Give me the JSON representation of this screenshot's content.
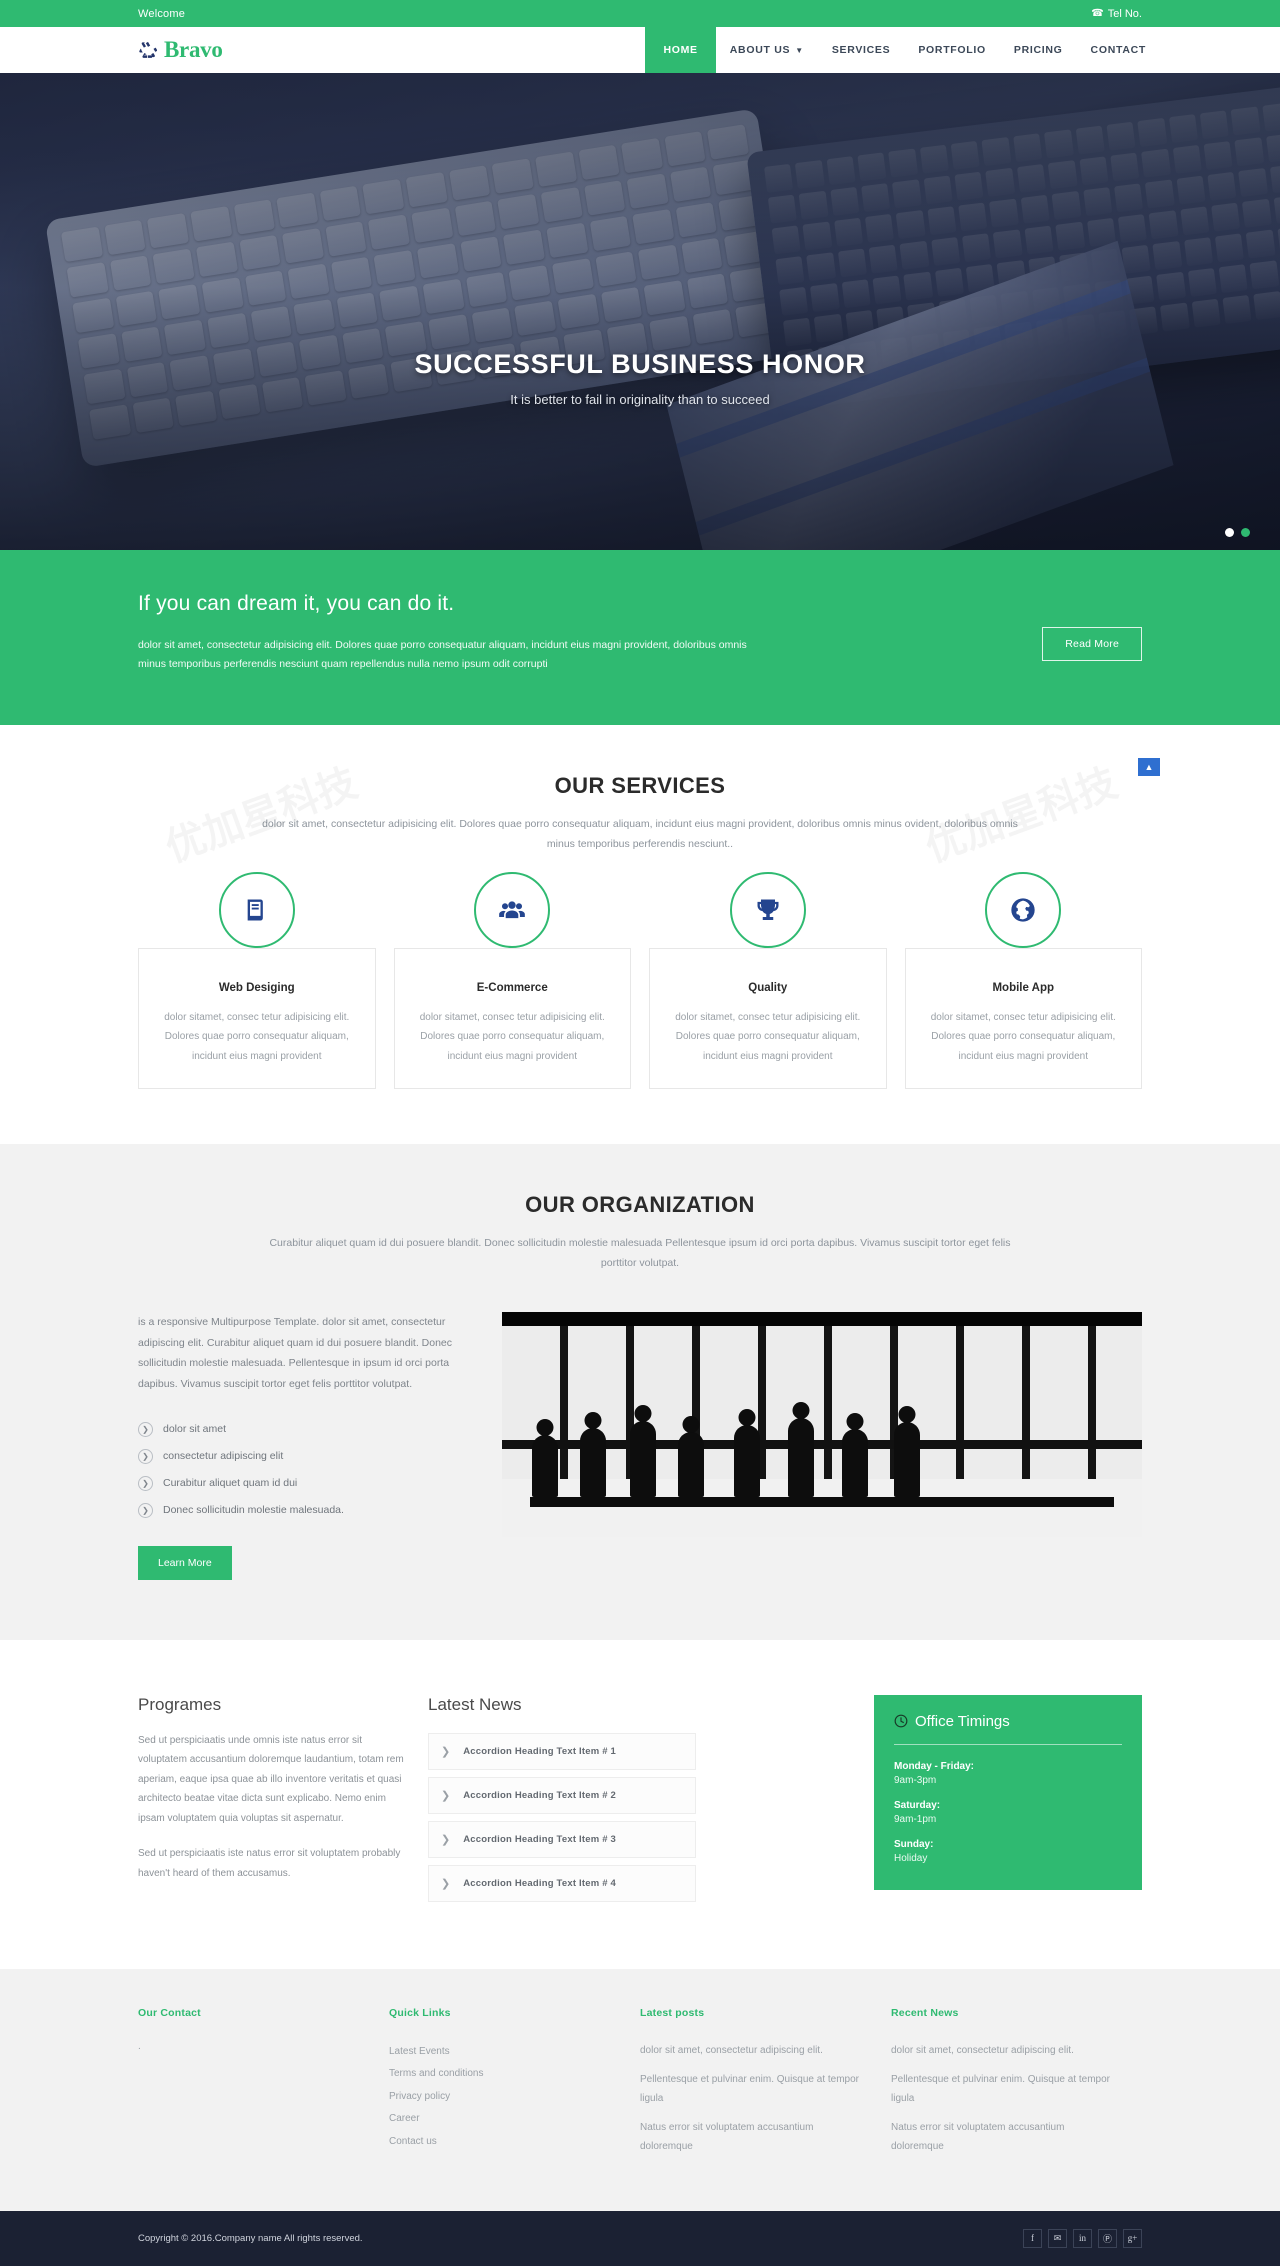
{
  "topbar": {
    "welcome": "Welcome",
    "tel": "Tel No.",
    "phone_icon": "phone-icon"
  },
  "brand": {
    "name": "Bravo",
    "icon": "recycle-icon"
  },
  "nav": {
    "items": [
      {
        "label": "HOME",
        "active": true,
        "caret": false
      },
      {
        "label": "ABOUT US",
        "active": false,
        "caret": true
      },
      {
        "label": "SERVICES",
        "active": false,
        "caret": false
      },
      {
        "label": "PORTFOLIO",
        "active": false,
        "caret": false
      },
      {
        "label": "PRICING",
        "active": false,
        "caret": false
      },
      {
        "label": "CONTACT",
        "active": false,
        "caret": false
      }
    ]
  },
  "hero": {
    "title": "SUCCESSFUL BUSINESS HONOR",
    "subtitle": "It is better to fail in originality than to succeed",
    "dots": [
      {
        "active": false
      },
      {
        "active": true
      }
    ]
  },
  "cta": {
    "title": "If you can dream it, you can do it.",
    "text": "dolor sit amet, consectetur adipisicing elit. Dolores quae porro consequatur aliquam, incidunt eius magni provident, doloribus omnis minus temporibus perferendis nesciunt quam repellendus nulla nemo ipsum odit corrupti",
    "button": "Read More"
  },
  "scrolltop": {
    "icon": "chevron-up-icon"
  },
  "services": {
    "title": "OUR SERVICES",
    "desc": "dolor sit amet, consectetur adipisicing elit. Dolores quae porro consequatur aliquam, incidunt eius magni provident, doloribus omnis minus ovident, doloribus omnis minus temporibus perferendis nesciunt..",
    "cards": [
      {
        "icon": "book-icon",
        "title": "Web Desiging",
        "text": "dolor sitamet, consec tetur adipisicing elit. Dolores quae porro consequatur aliquam, incidunt eius magni provident"
      },
      {
        "icon": "users-icon",
        "title": "E-Commerce",
        "text": "dolor sitamet, consec tetur adipisicing elit. Dolores quae porro consequatur aliquam, incidunt eius magni provident"
      },
      {
        "icon": "trophy-icon",
        "title": "Quality",
        "text": "dolor sitamet, consec tetur adipisicing elit. Dolores quae porro consequatur aliquam, incidunt eius magni provident"
      },
      {
        "icon": "globe-icon",
        "title": "Mobile App",
        "text": "dolor sitamet, consec tetur adipisicing elit. Dolores quae porro consequatur aliquam, incidunt eius magni provident"
      }
    ]
  },
  "organization": {
    "title": "OUR ORGANIZATION",
    "desc": "Curabitur aliquet quam id dui posuere blandit. Donec sollicitudin molestie malesuada Pellentesque ipsum id orci porta dapibus. Vivamus suscipit tortor eget felis porttitor volutpat.",
    "paragraph": "is a responsive Multipurpose Template. dolor sit amet, consectetur adipiscing elit. Curabitur aliquet quam id dui posuere blandit. Donec sollicitudin molestie malesuada. Pellentesque in ipsum id orci porta dapibus. Vivamus suscipit tortor eget felis porttitor volutpat.",
    "list": [
      "dolor sit amet",
      "consectetur adipiscing elit",
      "Curabitur aliquet quam id dui",
      "Donec sollicitudin molestie malesuada."
    ],
    "button": "Learn More",
    "image_alt": "boardroom-meeting-photo"
  },
  "programmes": {
    "title": "Programes",
    "paragraph1": "Sed ut perspiciaatis unde omnis iste natus error sit voluptatem accusantium doloremque laudantium, totam rem aperiam, eaque ipsa quae ab illo inventore veritatis et quasi architecto beatae vitae dicta sunt explicabo. Nemo enim ipsam voluptatem quia voluptas sit aspernatur.",
    "paragraph2": "Sed ut perspiciaatis iste natus error sit voluptatem probably haven't heard of them accusamus."
  },
  "latest_news": {
    "title": "Latest News",
    "items": [
      "Accordion Heading Text Item # 1",
      "Accordion Heading Text Item # 2",
      "Accordion Heading Text Item # 3",
      "Accordion Heading Text Item # 4"
    ]
  },
  "office_timings": {
    "title": "Office Timings",
    "icon": "clock-icon",
    "rows": [
      {
        "label": "Monday - Friday:",
        "value": "9am-3pm"
      },
      {
        "label": "Saturday:",
        "value": "9am-1pm"
      },
      {
        "label": "Sunday:",
        "value": "Holiday"
      }
    ]
  },
  "footer": {
    "columns": [
      {
        "heading": "Our Contact",
        "type": "contact",
        "text": "."
      },
      {
        "heading": "Quick Links",
        "type": "links",
        "items": [
          "Latest Events",
          "Terms and conditions",
          "Privacy policy",
          "Career",
          "Contact us"
        ]
      },
      {
        "heading": "Latest posts",
        "type": "posts",
        "items": [
          "dolor sit amet, consectetur adipiscing elit.",
          "Pellentesque et pulvinar enim. Quisque at tempor ligula",
          "Natus error sit voluptatem accusantium doloremque"
        ]
      },
      {
        "heading": "Recent News",
        "type": "posts",
        "items": [
          "dolor sit amet, consectetur adipiscing elit.",
          "Pellentesque et pulvinar enim. Quisque at tempor ligula",
          "Natus error sit voluptatem accusantium doloremque"
        ]
      }
    ]
  },
  "copyright": {
    "text": "Copyright © 2016.Company name All rights reserved.",
    "socials": [
      {
        "icon": "facebook-icon",
        "glyph": "f"
      },
      {
        "icon": "twitter-icon",
        "glyph": "✉"
      },
      {
        "icon": "linkedin-icon",
        "glyph": "in"
      },
      {
        "icon": "pinterest-icon",
        "glyph": "Ⓟ"
      },
      {
        "icon": "google-plus-icon",
        "glyph": "g+"
      }
    ]
  },
  "colors": {
    "accent": "#2fba71",
    "dark": "#1b2133",
    "icon_blue": "#24458f"
  }
}
